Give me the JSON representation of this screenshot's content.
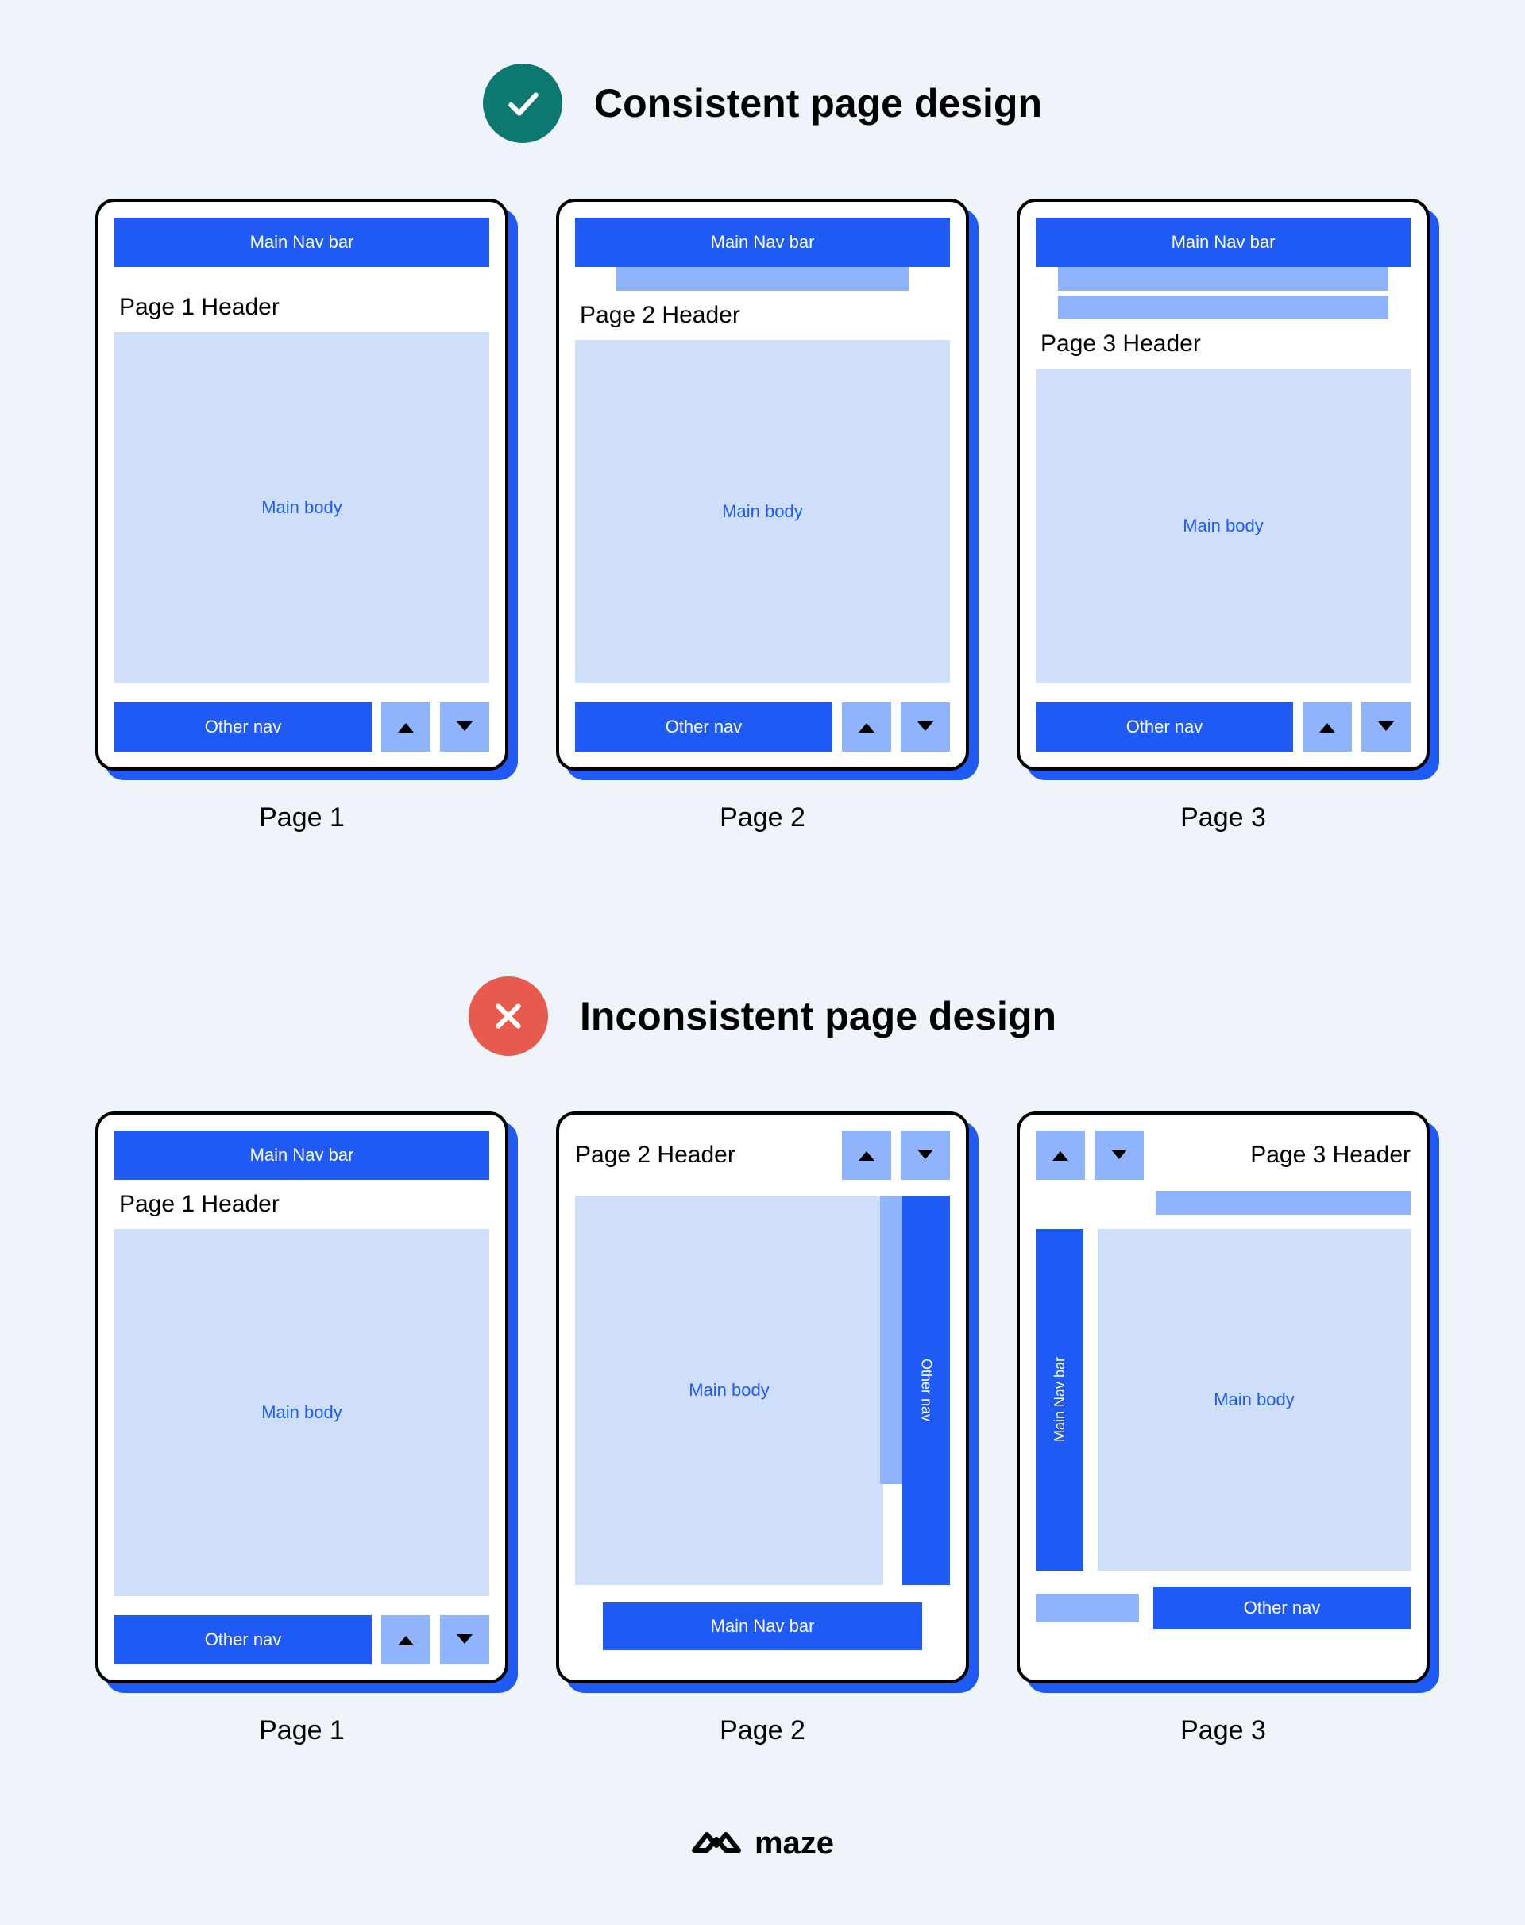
{
  "sections": {
    "consistent": {
      "title": "Consistent page design"
    },
    "inconsistent": {
      "title": "Inconsistent page design"
    }
  },
  "labels": {
    "main_nav": "Main Nav bar",
    "main_body": "Main body",
    "other_nav": "Other nav"
  },
  "consistent_pages": [
    {
      "header": "Page 1 Header",
      "label": "Page 1"
    },
    {
      "header": "Page 2 Header",
      "label": "Page 2"
    },
    {
      "header": "Page 3 Header",
      "label": "Page 3"
    }
  ],
  "inconsistent_pages": [
    {
      "header": "Page 1 Header",
      "label": "Page 1"
    },
    {
      "header": "Page 2 Header",
      "label": "Page 2"
    },
    {
      "header": "Page 3 Header",
      "label": "Page 3"
    }
  ],
  "brand": "maze"
}
